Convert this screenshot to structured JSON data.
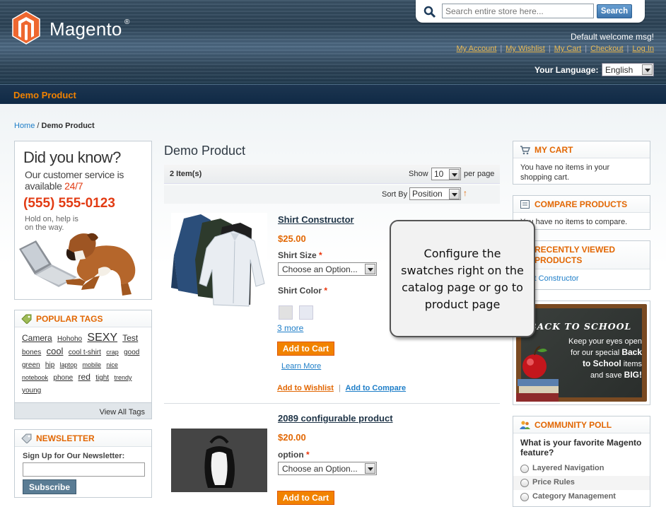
{
  "header": {
    "logo_text": "Magento",
    "logo_reg": "®",
    "search": {
      "placeholder": "Search entire store here...",
      "button": "Search"
    },
    "welcome": "Default welcome msg!",
    "top_links": [
      "My Account",
      "My Wishlist",
      "My Cart",
      "Checkout",
      "Log In"
    ],
    "language_label": "Your Language:",
    "language_value": "English"
  },
  "nav": {
    "title": "Demo Product"
  },
  "breadcrumb": {
    "home": "Home",
    "sep": " / ",
    "current": "Demo Product"
  },
  "did_you_know": {
    "title": "Did you know?",
    "line1": "Our customer service is",
    "line2": "available",
    "line2_highlight": "24/7",
    "phone": "(555) 555-0123",
    "hold1": "Hold on, help is",
    "hold2": "on the way."
  },
  "tags": {
    "title": "POPULAR TAGS",
    "items": [
      {
        "label": "Camera",
        "size": 12
      },
      {
        "label": "Hohoho",
        "size": 10
      },
      {
        "label": "SEXY",
        "size": 16
      },
      {
        "label": "Test",
        "size": 12
      },
      {
        "label": "bones",
        "size": 10
      },
      {
        "label": "cool",
        "size": 13
      },
      {
        "label": "cool t-shirt",
        "size": 10
      },
      {
        "label": "crap",
        "size": 9
      },
      {
        "label": "good",
        "size": 10
      },
      {
        "label": "green",
        "size": 10
      },
      {
        "label": "hip",
        "size": 10
      },
      {
        "label": "laptop",
        "size": 9
      },
      {
        "label": "mobile",
        "size": 9
      },
      {
        "label": "nice",
        "size": 9
      },
      {
        "label": "notebook",
        "size": 9
      },
      {
        "label": "phone",
        "size": 10
      },
      {
        "label": "red",
        "size": 12
      },
      {
        "label": "tight",
        "size": 10
      },
      {
        "label": "trendy",
        "size": 9
      },
      {
        "label": "young",
        "size": 10
      }
    ],
    "view_all": "View All Tags"
  },
  "newsletter": {
    "title": "NEWSLETTER",
    "label": "Sign Up for Our Newsletter:",
    "button": "Subscribe"
  },
  "catalog": {
    "title": "Demo Product",
    "items_count": "2 Item(s)",
    "show_label": "Show",
    "limit": "10",
    "per_page": "per page",
    "sort_label": "Sort By",
    "sort_value": "Position",
    "sort_dir": "↑"
  },
  "products": [
    {
      "name": "Shirt Constructor",
      "price": "$25.00",
      "option1_label": "Shirt Size",
      "option1_value": "Choose an Option...",
      "option2_label": "Shirt Color",
      "more": "3 more",
      "add_to_cart": "Add to Cart",
      "learn_more": "Learn More",
      "wishlist": "Add to Wishlist",
      "compare": "Add to Compare"
    },
    {
      "name": "2089 configurable product",
      "price": "$20.00",
      "option1_label": "option",
      "option1_value": "Choose an Option...",
      "add_to_cart": "Add to Cart"
    }
  ],
  "required_mark": "*",
  "link_sep": "|",
  "tooltip": {
    "text": "Configure the swatches right on the catalog page or go to product page"
  },
  "cart": {
    "title": "MY CART",
    "body": "You have no items in your shopping cart."
  },
  "compare": {
    "title": "COMPARE PRODUCTS",
    "body": "You have no items to compare."
  },
  "recent": {
    "title": "RECENTLY VIEWED PRODUCTS",
    "item": "Shirt Constructor"
  },
  "back_to_school": {
    "title": "BACK TO SCHOOL",
    "line1": "Keep your eyes open",
    "line2": "for our special",
    "line2_bold": "Back",
    "line3_bold": "to School",
    "line3": "items",
    "line4": "and save",
    "line4_bold": "BIG!"
  },
  "poll": {
    "title": "COMMUNITY POLL",
    "question": "What is your favorite Magento feature?",
    "options": [
      "Layered Navigation",
      "Price Rules",
      "Category Management"
    ]
  },
  "colors": {
    "accent": "#f18200",
    "link": "#1e7ec8",
    "header": "#2c4356"
  }
}
